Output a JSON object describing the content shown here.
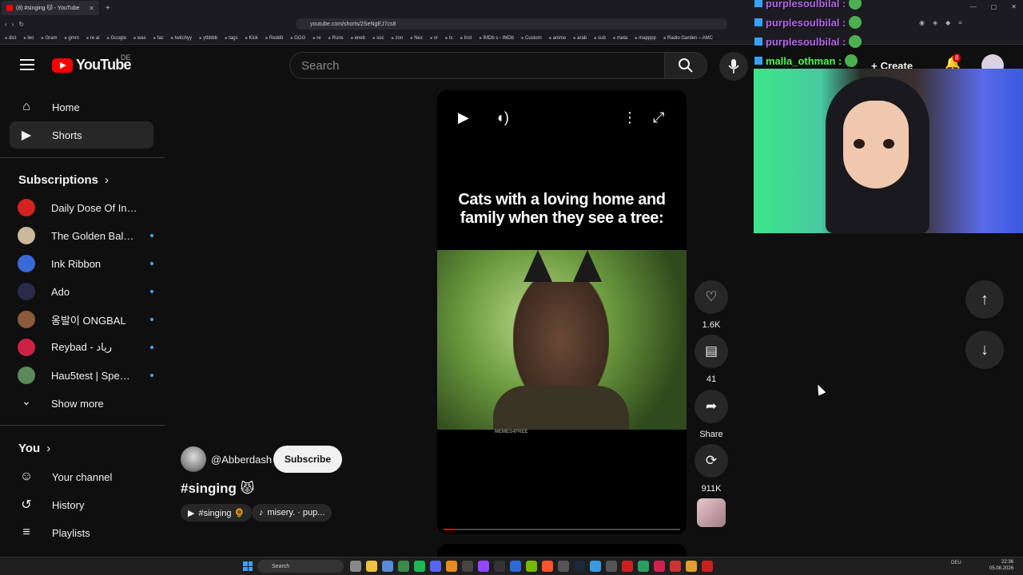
{
  "browser": {
    "tab_title": "(8) #singing 😽 - YouTube",
    "url": "youtube.com/shorts/2SeNgEJ7cs8",
    "bookmarks": [
      "dict",
      "leo",
      "Gram",
      "gmm",
      "re ai",
      "Google",
      "was",
      "fac",
      "twitchyy",
      "ytbbbb",
      "tags",
      "Kick",
      "Reddit",
      "GGG",
      "re",
      "Runs",
      "eneb",
      "soc",
      "zon",
      "Nex",
      "vr",
      "tc",
      "Inst",
      "IMDb s - IMDb",
      "Custom",
      "anime",
      "arab",
      "sub",
      "meta",
      "mapppp",
      "Radio Garden – AMC"
    ]
  },
  "header": {
    "logo_text": "YouTube",
    "country_code": "DE",
    "search_placeholder": "Search",
    "create_label": "Create",
    "notification_count": "8"
  },
  "sidebar": {
    "home_label": "Home",
    "shorts_label": "Shorts",
    "subscriptions_title": "Subscriptions",
    "subscriptions": [
      {
        "name": "Daily Dose Of Internet",
        "color": "#d22222",
        "new": false
      },
      {
        "name": "The Golden Balance",
        "color": "#c9b99a",
        "new": true
      },
      {
        "name": "Ink Ribbon",
        "color": "#3a6ad8",
        "new": true
      },
      {
        "name": "Ado",
        "color": "#2a2a4a",
        "new": true
      },
      {
        "name": "옹발이 ONGBAL",
        "color": "#8a5a3a",
        "new": true
      },
      {
        "name": "Reybad - رياد",
        "color": "#cc2244",
        "new": true
      },
      {
        "name": "Hau5test | Speedrun",
        "color": "#5a8a5a",
        "new": true
      }
    ],
    "show_more_label": "Show more",
    "you_title": "You",
    "your_channel_label": "Your channel",
    "history_label": "History",
    "playlists_label": "Playlists"
  },
  "short": {
    "caption": "Cats with a loving home and family when they see a tree:",
    "watermark": "MEMES4FREE",
    "progress": 0.05,
    "channel": "@Abberdash",
    "subscribe_label": "Subscribe",
    "title": "#singing 😾",
    "chip_tag": "#singing 🌻",
    "chip_sound": "misery. · pup..."
  },
  "actions": {
    "likes": "1.6K",
    "comments": "41",
    "share_label": "Share",
    "remixes": "911K"
  },
  "overlay": {
    "chat": [
      {
        "user": "purplesoulbilal :",
        "color": "#b565e8"
      },
      {
        "user": "purplesoulbilal :",
        "color": "#b565e8"
      },
      {
        "user": "purplesoulbilal :",
        "color": "#b565e8"
      },
      {
        "user": "malla_othman :",
        "color": "#4dff4d"
      }
    ]
  },
  "taskbar": {
    "search_label": "Search",
    "lang": "DEU",
    "time": "22:36",
    "date": "05.08.2026"
  }
}
